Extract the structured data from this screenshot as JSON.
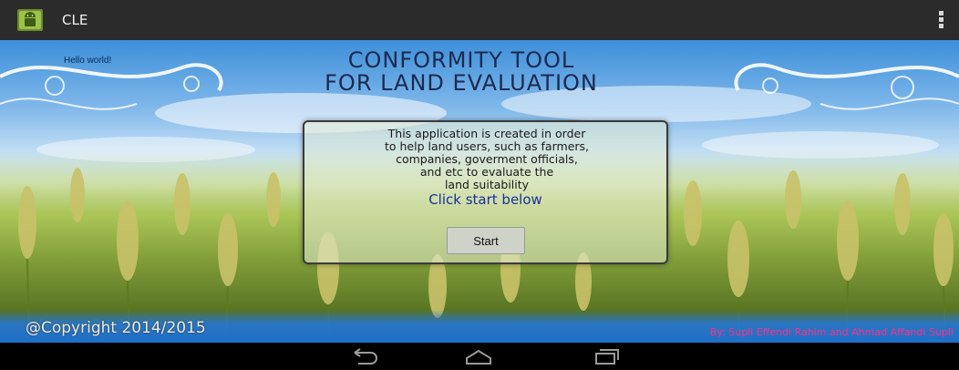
{
  "action_bar": {
    "title": "CLE",
    "app_icon": "android-robot-icon",
    "overflow_icon": "overflow-menu-icon"
  },
  "main": {
    "hello_text": "Hello world!",
    "title_line1": "CONFORMITY TOOL",
    "title_line2": "FOR LAND EVALUATION",
    "description_lines": [
      "This application is created  in order",
      "to help land users, such as farmers,",
      "companies, goverment officials,",
      "and etc to evaluate the",
      "land suitability"
    ],
    "cta": "Click start below",
    "start_button": "Start"
  },
  "footer": {
    "copyright": "@Copyright 2014/2015",
    "authors": "By: Supli Effendi Rahim and Ahmad Affandi Supli"
  },
  "nav_bar": {
    "back_icon": "back-icon",
    "home_icon": "home-icon",
    "recents_icon": "recents-icon"
  }
}
